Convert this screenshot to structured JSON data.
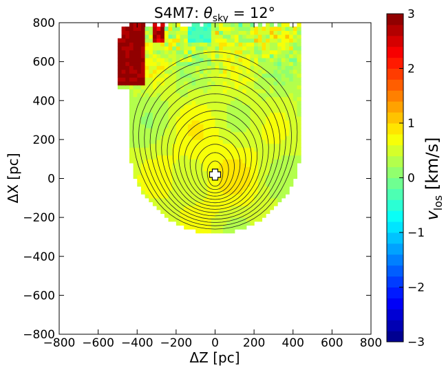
{
  "chart_data": {
    "type": "heatmap",
    "title": {
      "prefix": "S4M7:  ",
      "theta": "θ",
      "sub": "sky",
      "suffix": " = 12°"
    },
    "xlabel": "ΔZ [pc]",
    "ylabel": "ΔX [pc]",
    "xlim": [
      -800,
      800
    ],
    "ylim": [
      -800,
      800
    ],
    "x_ticks": [
      -800,
      -600,
      -400,
      -200,
      0,
      200,
      400,
      600,
      800
    ],
    "y_ticks": [
      -800,
      -600,
      -400,
      -200,
      0,
      200,
      400,
      600,
      800
    ],
    "colorbar": {
      "label_main": "v",
      "label_sub": "los",
      "label_units": " [km/s]",
      "range": [
        -3,
        3
      ],
      "ticks": [
        -3,
        -2,
        -1,
        0,
        1,
        2,
        3
      ],
      "colormap": "jet"
    },
    "center_marker": {
      "x": 0,
      "y": 20,
      "shape": "cross"
    },
    "contour_count": 14
  }
}
